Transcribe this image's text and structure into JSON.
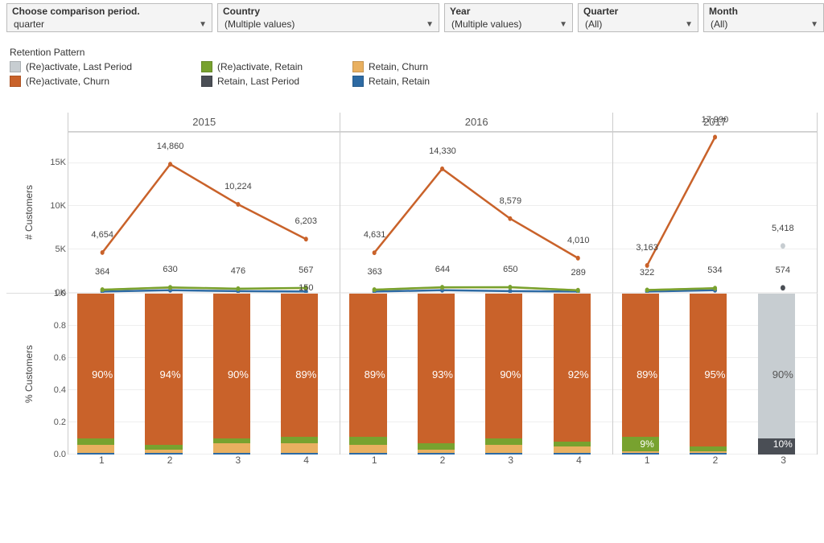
{
  "filters": {
    "comparison": {
      "label": "Choose comparison period.",
      "value": "quarter"
    },
    "country": {
      "label": "Country",
      "value": "(Multiple values)"
    },
    "year": {
      "label": "Year",
      "value": "(Multiple values)"
    },
    "quarter": {
      "label": "Quarter",
      "value": "(All)"
    },
    "month": {
      "label": "Month",
      "value": "(All)"
    }
  },
  "legend": {
    "title": "Retention Pattern",
    "items": [
      {
        "name": "(Re)activate, Last Period",
        "color": "#c7cdd1"
      },
      {
        "name": "(Re)activate, Churn",
        "color": "#c9622a"
      },
      {
        "name": "(Re)activate, Retain",
        "color": "#78a22f"
      },
      {
        "name": "Retain, Last Period",
        "color": "#4a4e55"
      },
      {
        "name": "Retain, Churn",
        "color": "#e9b060"
      },
      {
        "name": "Retain, Retain",
        "color": "#2d6aa3"
      }
    ]
  },
  "axes": {
    "top": {
      "label": "# Customers",
      "ticks": [
        {
          "v": 0,
          "t": "0K"
        },
        {
          "v": 5000,
          "t": "5K"
        },
        {
          "v": 10000,
          "t": "10K"
        },
        {
          "v": 15000,
          "t": "15K"
        }
      ],
      "max": 18500
    },
    "bottom": {
      "label": "% Customers",
      "ticks": [
        {
          "v": 0,
          "t": "0.0"
        },
        {
          "v": 0.2,
          "t": "0.2"
        },
        {
          "v": 0.4,
          "t": "0.4"
        },
        {
          "v": 0.6,
          "t": "0.6"
        },
        {
          "v": 0.8,
          "t": "0.8"
        },
        {
          "v": 1.0,
          "t": "1.0"
        }
      ],
      "max": 1.0
    }
  },
  "chart_data": {
    "type": "line+stacked-bar",
    "x_categories": [
      1,
      2,
      3,
      4
    ],
    "panels": [
      {
        "year": "2015",
        "quarters": [
          1,
          2,
          3,
          4
        ],
        "lines": {
          "reactivate_churn": [
            4654,
            14860,
            10224,
            6203
          ],
          "reactivate_retain": [
            364,
            630,
            476,
            567
          ],
          "retain_churn": [
            360,
            600,
            470,
            550
          ],
          "retain_retain": [
            150,
            300,
            200,
            150
          ]
        },
        "line_labels": {
          "top": [
            "4,654",
            "14,860",
            "10,224",
            "6,203"
          ],
          "mid": [
            "364",
            "630",
            "476",
            "567"
          ],
          "low": [
            "",
            "",
            "",
            "150"
          ]
        },
        "bars_pct": {
          "reactivate_churn": [
            0.9,
            0.94,
            0.9,
            0.89
          ],
          "reactivate_retain": [
            0.04,
            0.03,
            0.03,
            0.04
          ],
          "retain_churn": [
            0.05,
            0.02,
            0.06,
            0.06
          ],
          "retain_retain": [
            0.01,
            0.01,
            0.01,
            0.01
          ]
        },
        "bar_big_label": [
          "90%",
          "94%",
          "90%",
          "89%"
        ],
        "bar_extra_label": [
          "",
          "",
          "",
          ""
        ]
      },
      {
        "year": "2016",
        "quarters": [
          1,
          2,
          3,
          4
        ],
        "lines": {
          "reactivate_churn": [
            4631,
            14330,
            8579,
            4010
          ],
          "reactivate_retain": [
            363,
            644,
            650,
            289
          ],
          "retain_churn": [
            360,
            620,
            630,
            300
          ],
          "retain_retain": [
            150,
            300,
            200,
            150
          ]
        },
        "line_labels": {
          "top": [
            "4,631",
            "14,330",
            "8,579",
            "4,010"
          ],
          "mid": [
            "363",
            "644",
            "650",
            "289"
          ],
          "low": [
            "",
            "",
            "",
            ""
          ]
        },
        "bars_pct": {
          "reactivate_churn": [
            0.89,
            0.93,
            0.9,
            0.92
          ],
          "reactivate_retain": [
            0.05,
            0.04,
            0.04,
            0.03
          ],
          "retain_churn": [
            0.05,
            0.02,
            0.05,
            0.04
          ],
          "retain_retain": [
            0.01,
            0.01,
            0.01,
            0.01
          ]
        },
        "bar_big_label": [
          "89%",
          "93%",
          "90%",
          "92%"
        ],
        "bar_extra_label": [
          "",
          "",
          "",
          ""
        ]
      },
      {
        "year": "2017",
        "quarters": [
          1,
          2,
          3
        ],
        "lines": {
          "reactivate_churn": [
            3163,
            17990,
            null
          ],
          "reactivate_retain": [
            322,
            534,
            null
          ],
          "retain_churn": [
            320,
            520,
            null
          ],
          "retain_retain": [
            150,
            300,
            null
          ]
        },
        "lone_points": {
          "reactivate_last_period": {
            "q": 3,
            "v": 5418,
            "label": "5,418"
          },
          "retain_last_period": {
            "q": 3,
            "v": 574,
            "label": "574"
          }
        },
        "line_labels": {
          "top": [
            "3,163",
            "17,990",
            ""
          ],
          "mid": [
            "322",
            "534",
            ""
          ],
          "low": [
            "",
            "",
            ""
          ]
        },
        "bars_pct": {
          "reactivate_churn": [
            0.89,
            0.95,
            0.0
          ],
          "reactivate_retain": [
            0.09,
            0.03,
            0.0
          ],
          "retain_churn": [
            0.01,
            0.01,
            0.0
          ],
          "retain_retain": [
            0.01,
            0.01,
            0.0
          ],
          "reactivate_last_period": [
            0.0,
            0.0,
            0.9
          ],
          "retain_last_period": [
            0.0,
            0.0,
            0.1
          ]
        },
        "bar_big_label": [
          "89%",
          "95%",
          "90%"
        ],
        "bar_extra_label": [
          "9%",
          "",
          "10%"
        ]
      }
    ]
  }
}
